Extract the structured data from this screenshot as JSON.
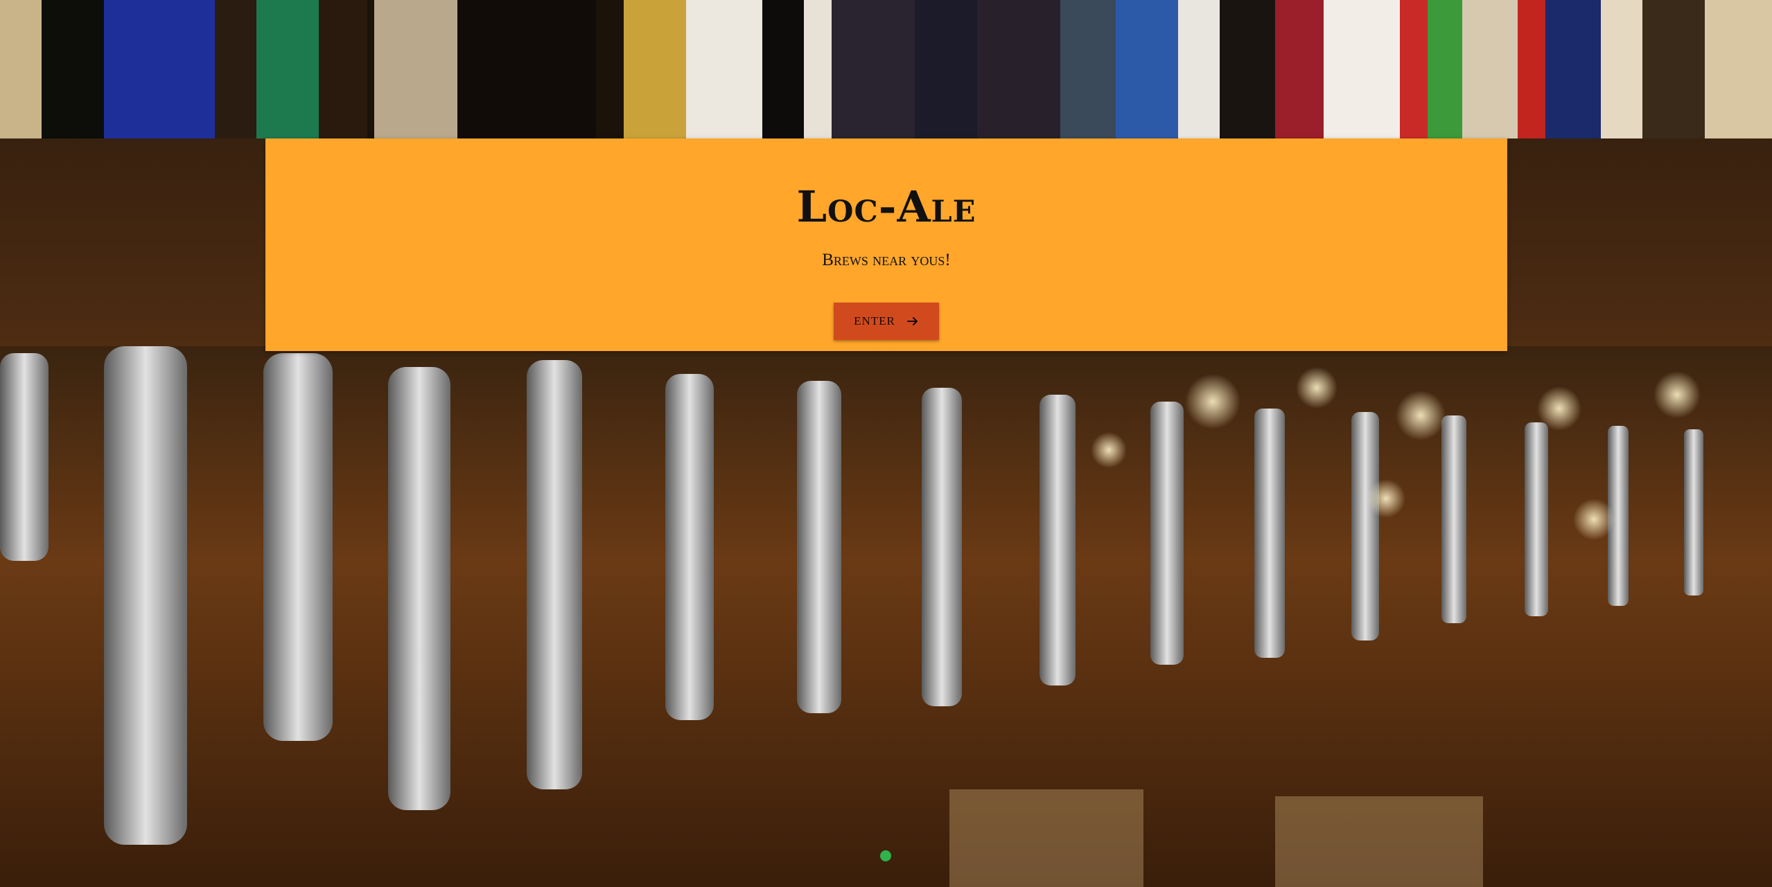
{
  "hero": {
    "title": "Loc-Ale",
    "subtitle": "Brews near yous!",
    "enter_label": "ENTER"
  },
  "background": {
    "description_icon": "beer-taps-photo"
  },
  "carousel": {
    "active_index": 1,
    "dot_count": 1
  },
  "colors": {
    "panel": "#ffa62b",
    "button": "#d14a1e",
    "dot": "#2fb34a"
  }
}
